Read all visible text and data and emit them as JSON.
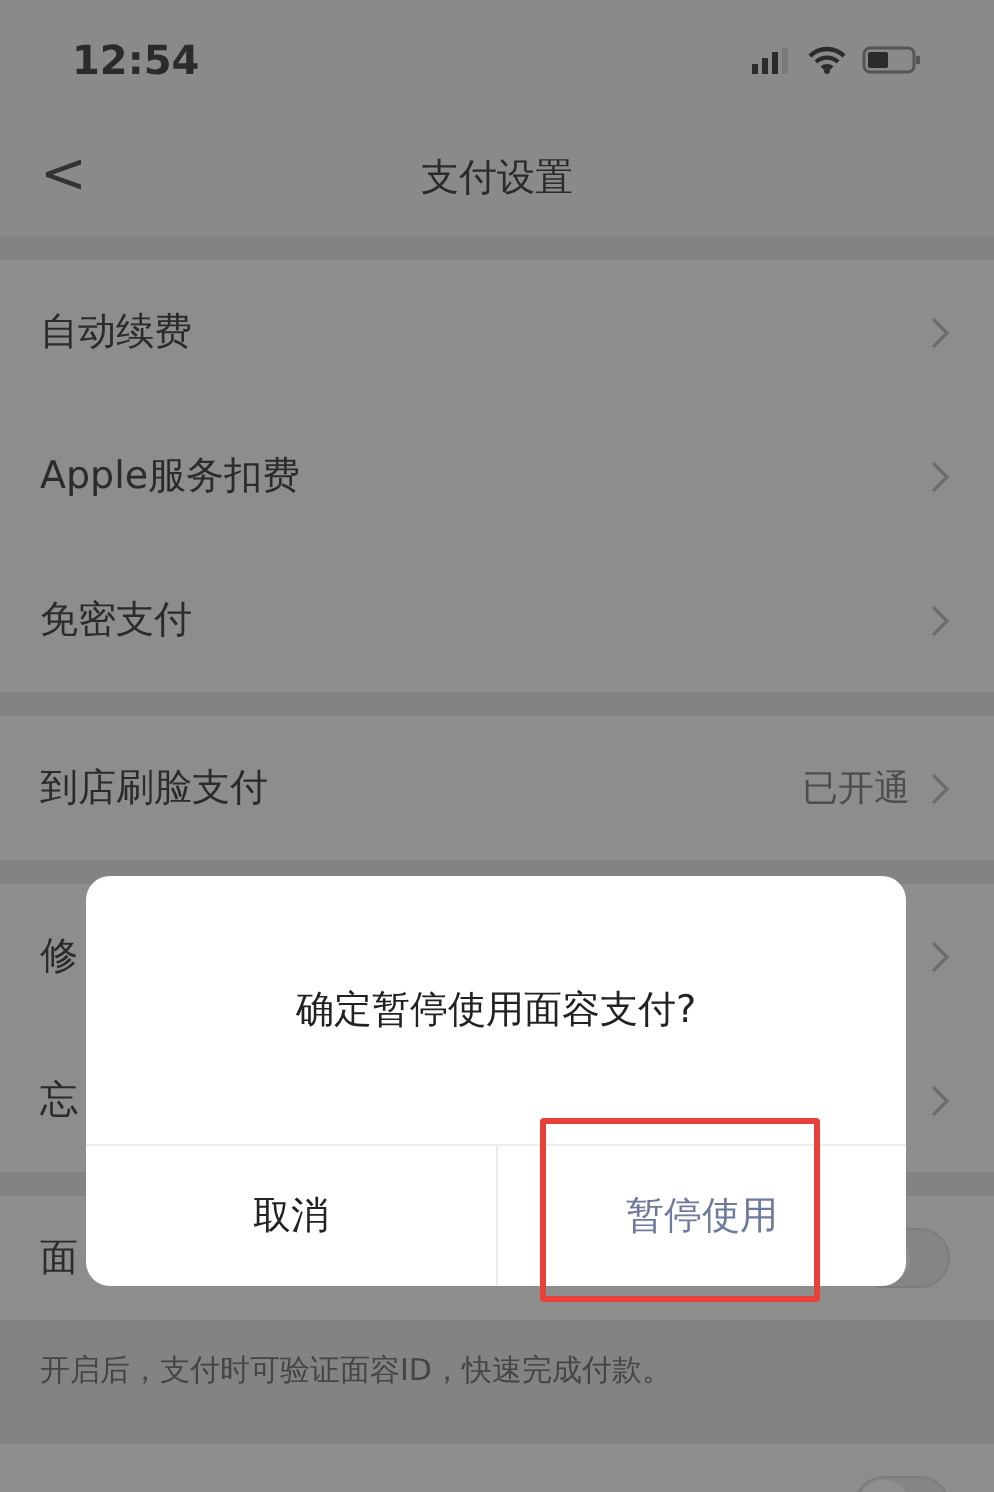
{
  "status_bar": {
    "time": "12:54"
  },
  "nav": {
    "back": "<",
    "title": "支付设置"
  },
  "groups": [
    {
      "rows": [
        {
          "kind": "link",
          "label": "自动续费"
        },
        {
          "kind": "link",
          "label": "Apple服务扣费"
        },
        {
          "kind": "link",
          "label": "免密支付"
        }
      ]
    },
    {
      "rows": [
        {
          "kind": "link",
          "label": "到店刷脸支付",
          "value": "已开通"
        }
      ]
    },
    {
      "rows": [
        {
          "kind": "link",
          "label": "修"
        },
        {
          "kind": "link",
          "label": "忘"
        }
      ]
    },
    {
      "rows": [
        {
          "kind": "toggle",
          "label": "面",
          "on": false
        }
      ],
      "hint": "开启后，支付时可验证面容ID，快速完成付款。"
    },
    {
      "rows": [
        {
          "kind": "toggle",
          "on": false
        }
      ]
    }
  ],
  "dialog": {
    "message": "确定暂停使用面容支付?",
    "buttons": [
      {
        "label": "取消",
        "kind": "cancel",
        "highlighted": false
      },
      {
        "label": "暂停使用",
        "kind": "confirm",
        "highlighted": true
      }
    ]
  }
}
